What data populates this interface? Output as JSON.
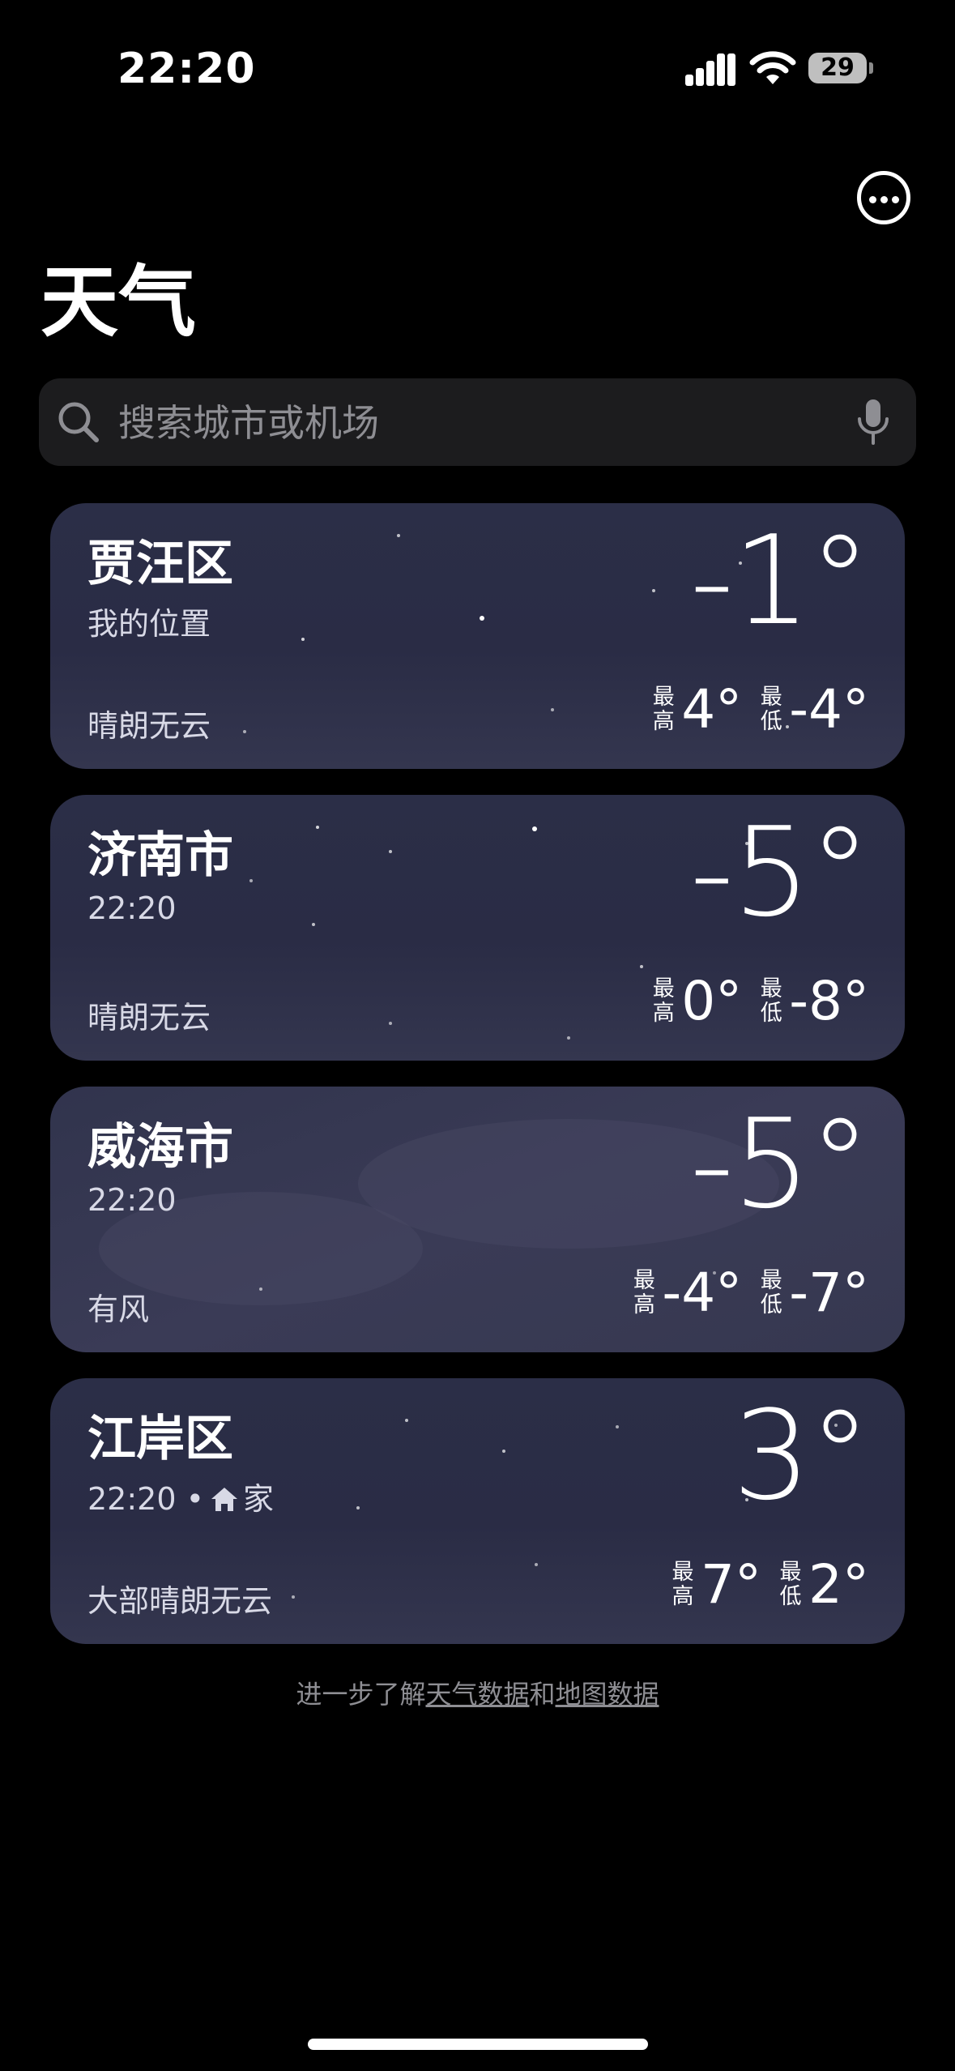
{
  "status": {
    "time": "22:20",
    "battery": "29"
  },
  "header": {
    "title": "天气"
  },
  "search": {
    "placeholder": "搜索城市或机场"
  },
  "cities": [
    {
      "name": "贾汪区",
      "subtitle": "我的位置",
      "condition": "晴朗无云",
      "temp": "-1°",
      "high_label": "最高",
      "high": "4°",
      "low_label": "最低",
      "low": "-4°"
    },
    {
      "name": "济南市",
      "subtitle": "22:20",
      "condition": "晴朗无云",
      "temp": "-5°",
      "high_label": "最高",
      "high": "0°",
      "low_label": "最低",
      "low": "-8°"
    },
    {
      "name": "威海市",
      "subtitle": "22:20",
      "condition": "有风",
      "temp": "-5°",
      "high_label": "最高",
      "high": "-4°",
      "low_label": "最低",
      "low": "-7°"
    },
    {
      "name": "江岸区",
      "subtitle": "22:20 •",
      "subtitle_home": "家",
      "condition": "大部晴朗无云",
      "temp": "3°",
      "high_label": "最高",
      "high": "7°",
      "low_label": "最低",
      "low": "2°"
    }
  ],
  "footer": {
    "prefix": "进一步了解",
    "weather_link": "天气数据",
    "and": "和",
    "map_link": "地图数据"
  }
}
